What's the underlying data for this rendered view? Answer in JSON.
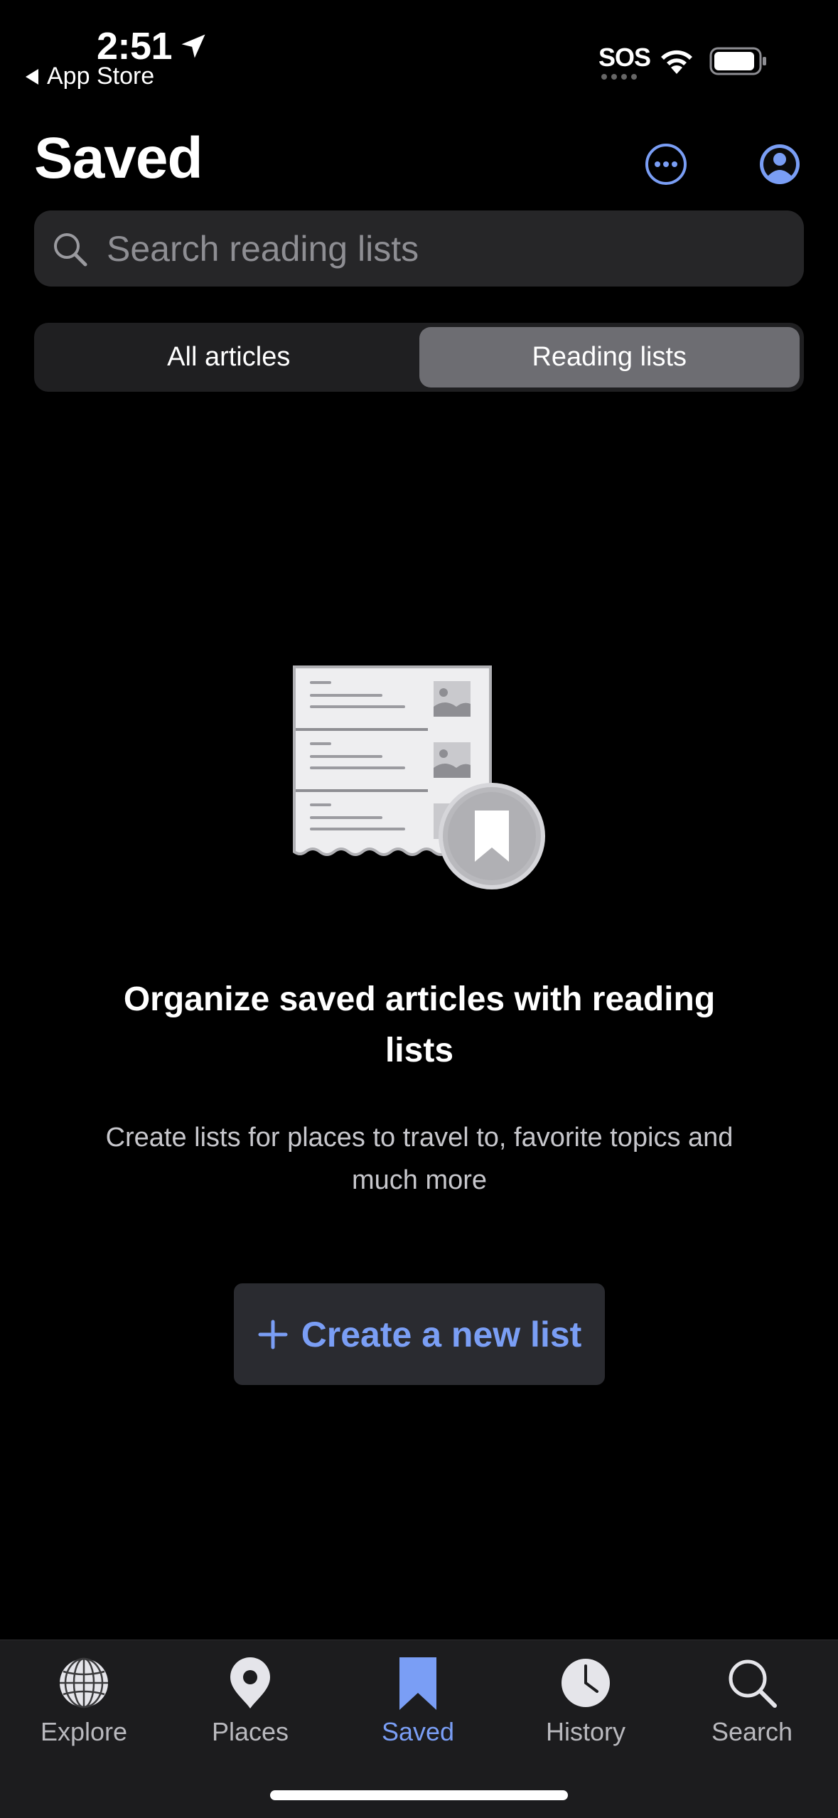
{
  "status_bar": {
    "time": "2:51",
    "back_label": "App Store",
    "carrier": "SOS"
  },
  "header": {
    "title": "Saved"
  },
  "search": {
    "placeholder": "Search reading lists"
  },
  "segmented_control": {
    "options": [
      "All articles",
      "Reading lists"
    ],
    "selected": "Reading lists"
  },
  "empty_state": {
    "title": "Organize saved articles with reading lists",
    "description": "Create lists for places to travel to, favorite topics and much more",
    "button_label": "Create a new list"
  },
  "tab_bar": {
    "items": [
      {
        "label": "Explore",
        "icon": "globe-icon"
      },
      {
        "label": "Places",
        "icon": "map-pin-icon"
      },
      {
        "label": "Saved",
        "icon": "bookmark-icon",
        "active": true
      },
      {
        "label": "History",
        "icon": "clock-icon"
      },
      {
        "label": "Search",
        "icon": "search-icon"
      }
    ]
  },
  "colors": {
    "accent": "#7a9ef5",
    "background": "#000000",
    "surface": "#262628"
  }
}
